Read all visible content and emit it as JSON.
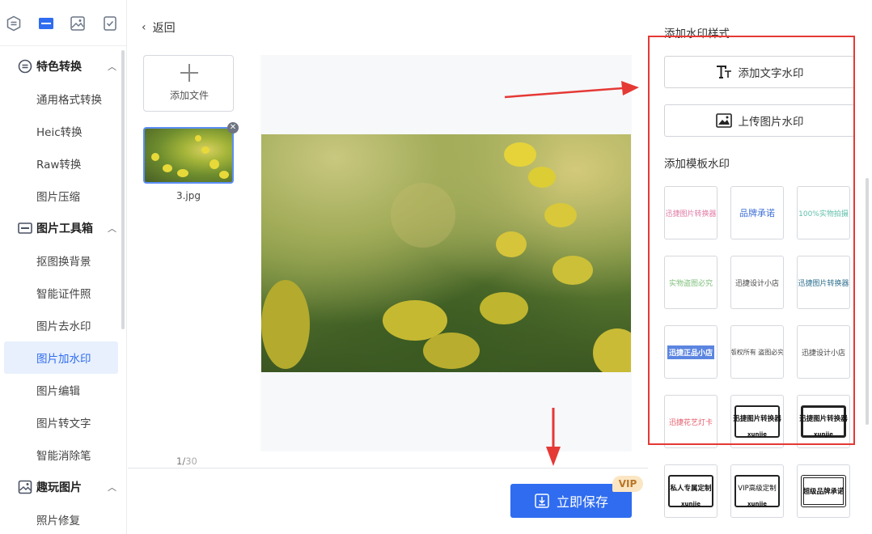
{
  "sidebar": {
    "top_icons": [
      "convert-icon",
      "toolbox-icon",
      "fun-image-icon",
      "checklist-icon"
    ],
    "sections": [
      {
        "label": "特色转换",
        "icon": "convert-icon",
        "items": [
          "通用格式转换",
          "Heic转换",
          "Raw转换",
          "图片压缩"
        ]
      },
      {
        "label": "图片工具箱",
        "icon": "toolbox-icon",
        "items": [
          "抠图换背景",
          "智能证件照",
          "图片去水印",
          "图片加水印",
          "图片编辑",
          "图片转文字",
          "智能消除笔"
        ]
      },
      {
        "label": "趣玩图片",
        "icon": "fun-image-icon",
        "items": [
          "照片修复"
        ]
      }
    ],
    "active_item": "图片加水印"
  },
  "center": {
    "back_label": "返回",
    "add_file_label": "添加文件",
    "file_name": "3.jpg",
    "page_current": "1/",
    "page_total": "30",
    "save_label": "立即保存",
    "vip_badge": "VIP"
  },
  "right": {
    "style_title": "添加水印样式",
    "add_text_label": "添加文字水印",
    "upload_image_label": "上传图片水印",
    "template_title": "添加模板水印",
    "templates": [
      "迅捷图片转换器",
      "品牌承诺",
      "100%实物拍摄",
      "实物盗图必究",
      "迅捷设计小店",
      "迅捷图片转换器",
      "迅捷正品小店",
      "版权所有 盗图必究",
      "迅捷设计小店",
      "迅捷花艺灯卡",
      "迅捷图片转换器",
      "迅捷图片转换器",
      "私人专属定制",
      "VIP高级定制",
      "超级品牌承诺"
    ],
    "template_sub": "xunjie"
  },
  "colors": {
    "accent": "#2f6cf0",
    "annotation": "#e53935",
    "active_bg": "#e8f0fd"
  }
}
